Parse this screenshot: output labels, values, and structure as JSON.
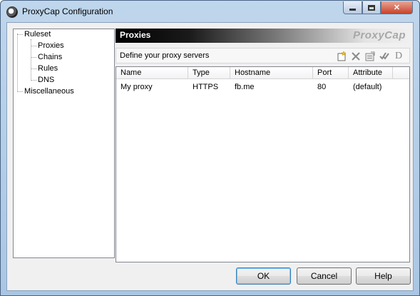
{
  "window": {
    "title": "ProxyCap Configuration"
  },
  "tree": {
    "items": [
      {
        "label": "Ruleset"
      },
      {
        "label": "Proxies"
      },
      {
        "label": "Chains"
      },
      {
        "label": "Rules"
      },
      {
        "label": "DNS"
      },
      {
        "label": "Miscellaneous"
      }
    ]
  },
  "panel": {
    "title": "Proxies",
    "brand": "ProxyCap",
    "description": "Define your proxy servers",
    "toolbar": {
      "icons": [
        "new-proxy-icon",
        "delete-icon",
        "properties-icon",
        "check-icon",
        "default-icon"
      ],
      "default_label": "D"
    }
  },
  "proxy_list": {
    "columns": [
      "Name",
      "Type",
      "Hostname",
      "Port",
      "Attribute"
    ],
    "rows": [
      {
        "name": "My proxy",
        "type": "HTTPS",
        "hostname": "fb.me",
        "port": "80",
        "attribute": "(default)"
      }
    ]
  },
  "buttons": {
    "ok": "OK",
    "cancel": "Cancel",
    "help": "Help"
  }
}
